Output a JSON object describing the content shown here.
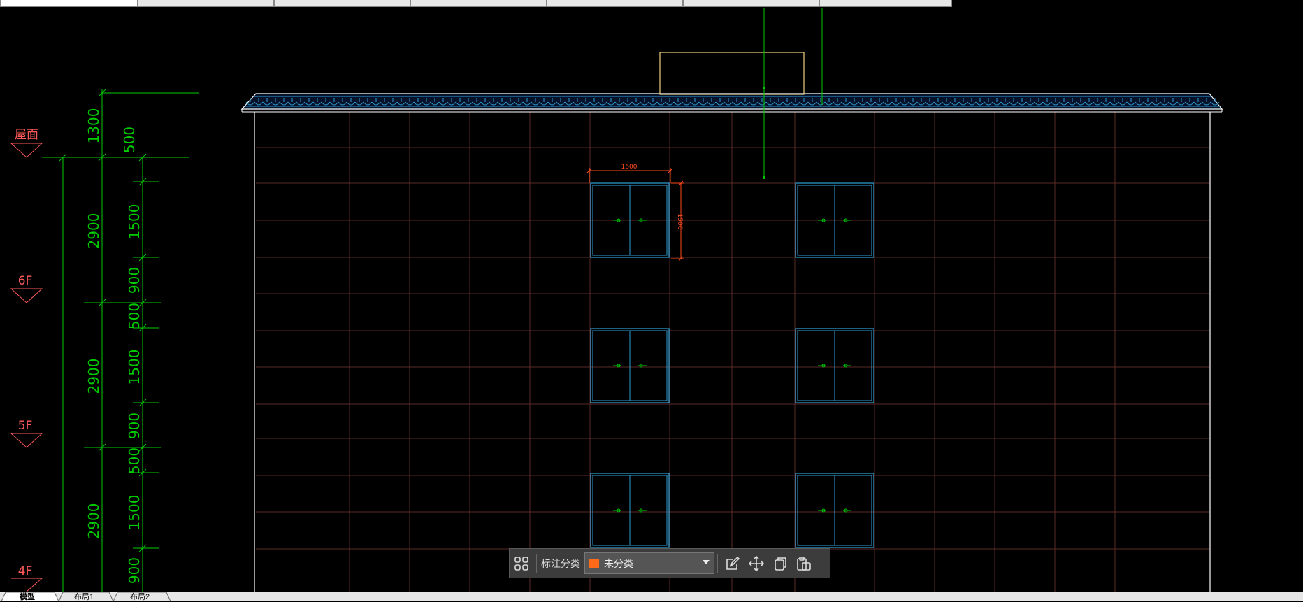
{
  "colors": {
    "background": "#000000",
    "grid": "#5a2a28",
    "dimension": "#00cc00",
    "level_marker": "#ff5a5a",
    "window": "#2f9fd8",
    "dim_red": "#ff4a1a",
    "outline": "#ffffff",
    "chimney": "#f0d080",
    "category_swatch": "#ff6a1a"
  },
  "top_tabs": [
    "",
    "",
    "",
    "",
    "",
    "",
    ""
  ],
  "drawing": {
    "levels": [
      {
        "label": "屋面"
      },
      {
        "label": "6F"
      },
      {
        "label": "5F"
      },
      {
        "label": "4F"
      }
    ],
    "dims_outer": [
      "1300",
      "2900",
      "2900",
      "2900"
    ],
    "dims_inner": [
      "500",
      "1500",
      "900",
      "500",
      "1500",
      "900",
      "500",
      "1500",
      "900"
    ],
    "window_width_label": "1600",
    "window_height_label": "1500"
  },
  "toolbar": {
    "grid_icon": "grid-icon",
    "label": "标注分类",
    "select_value": "未分类",
    "edit_icon": "edit-icon",
    "move_icon": "move-icon",
    "copy_icon": "copy-icon",
    "paste_icon": "paste-icon"
  },
  "layout_tabs": [
    "模型",
    "布局1",
    "布局2"
  ]
}
